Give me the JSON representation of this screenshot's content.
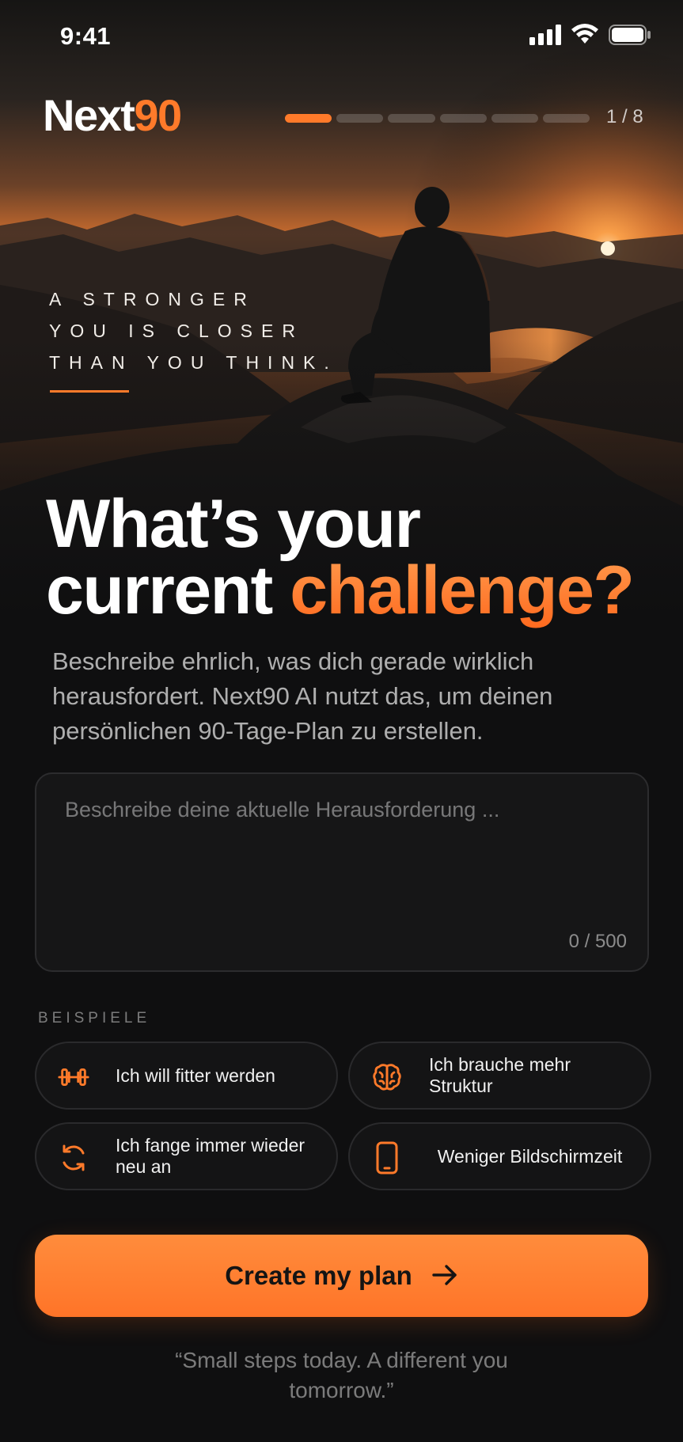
{
  "status_bar": {
    "time": "9:41",
    "icons": [
      "cellular-signal-icon",
      "wifi-icon",
      "battery-icon"
    ]
  },
  "header": {
    "logo_part1": "Next",
    "logo_part2": "90",
    "progress": {
      "current": 1,
      "total": 8,
      "label": "1 / 8"
    }
  },
  "hero": {
    "tagline_lines": [
      "A STRONGER",
      "YOU IS CLOSER",
      "THAN YOU THINK."
    ]
  },
  "headline": {
    "line1": "What’s your",
    "line2_plain": "current ",
    "line2_accent": "challenge?"
  },
  "subtitle": "Beschreibe ehrlich, was dich gerade wirklich herausfordert. Next90 AI nutzt das, um deinen persönlichen 90-Tage-Plan zu erstellen.",
  "input": {
    "value": "",
    "placeholder": "Beschreibe deine aktuelle Herausforderung ...",
    "counter": "0 / 500"
  },
  "examples": {
    "label": "BEISPIELE",
    "items": [
      {
        "icon": "dumbbell-icon",
        "label": "Ich will fitter werden"
      },
      {
        "icon": "brain-icon",
        "label": "Ich brauche mehr Struktur"
      },
      {
        "icon": "refresh-icon",
        "label": "Ich fange immer wieder neu an"
      },
      {
        "icon": "smartphone-icon",
        "label": "Weniger Bildschirmzeit"
      }
    ]
  },
  "cta": {
    "label": "Create my plan",
    "icon": "arrow-right-icon"
  },
  "quote": "“Small steps today. A different you tomorrow.”",
  "colors": {
    "accent": "#ff7a2a",
    "background": "#0f0f10",
    "card": "#161617"
  }
}
